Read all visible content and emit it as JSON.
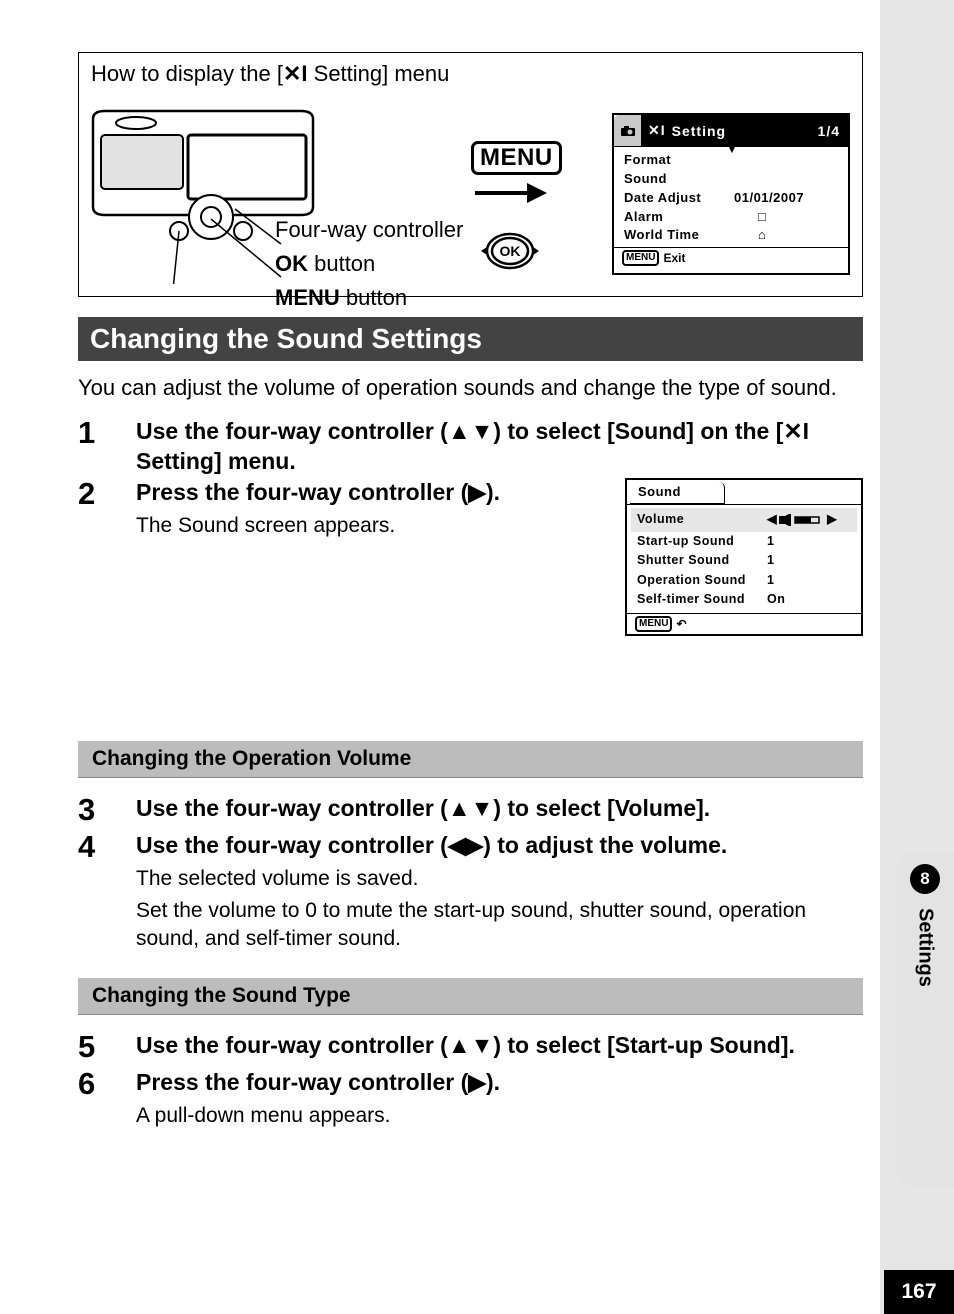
{
  "intro": {
    "title_a": "How to display the [",
    "title_b": " Setting] menu",
    "four_way": "Four-way controller",
    "ok_bold": "OK",
    "ok_b": " button",
    "menu_bold": "MENU",
    "menu_b": " button",
    "menu_badge": "MENU",
    "ok_badge": "OK"
  },
  "screen1": {
    "tab_label": "Setting",
    "page": "1/4",
    "rows": [
      {
        "label": "Format",
        "val": ""
      },
      {
        "label": "Sound",
        "val": ""
      },
      {
        "label": "Date Adjust",
        "val": "01/01/2007"
      },
      {
        "label": "Alarm",
        "val": "□"
      },
      {
        "label": "World Time",
        "val": "⌂"
      }
    ],
    "exit": "Exit"
  },
  "section": "Changing the Sound Settings",
  "intro_text": "You can adjust the volume of operation sounds and change the type of sound.",
  "steps": {
    "s1": "Use the four-way controller (▲▼) to select [Sound] on the [",
    "s1b": " Setting] menu.",
    "s2": "Press the four-way controller (▶).",
    "s2_sub": "The Sound screen appears.",
    "s3": "Use the four-way controller (▲▼) to select [Volume].",
    "s4": "Use the four-way controller (◀▶) to adjust the volume.",
    "s4_sub1": "The selected volume is saved.",
    "s4_sub2": "Set the volume to 0 to mute the start-up sound, shutter sound, operation sound, and self-timer sound.",
    "s5": "Use the four-way controller (▲▼) to select [Start-up Sound].",
    "s6": "Press the four-way controller (▶).",
    "s6_sub": "A pull-down menu appears."
  },
  "sub_head1": "Changing the Operation Volume",
  "sub_head2": "Changing the Sound Type",
  "screen2": {
    "tab": "Sound",
    "rows": [
      {
        "label": "Volume",
        "val": ""
      },
      {
        "label": "Start-up Sound",
        "val": "1"
      },
      {
        "label": "Shutter Sound",
        "val": "1"
      },
      {
        "label": "Operation Sound",
        "val": "1"
      },
      {
        "label": "Self-timer Sound",
        "val": "On"
      }
    ]
  },
  "side": {
    "chapter": "8",
    "label": "Settings"
  },
  "page_number": "167"
}
